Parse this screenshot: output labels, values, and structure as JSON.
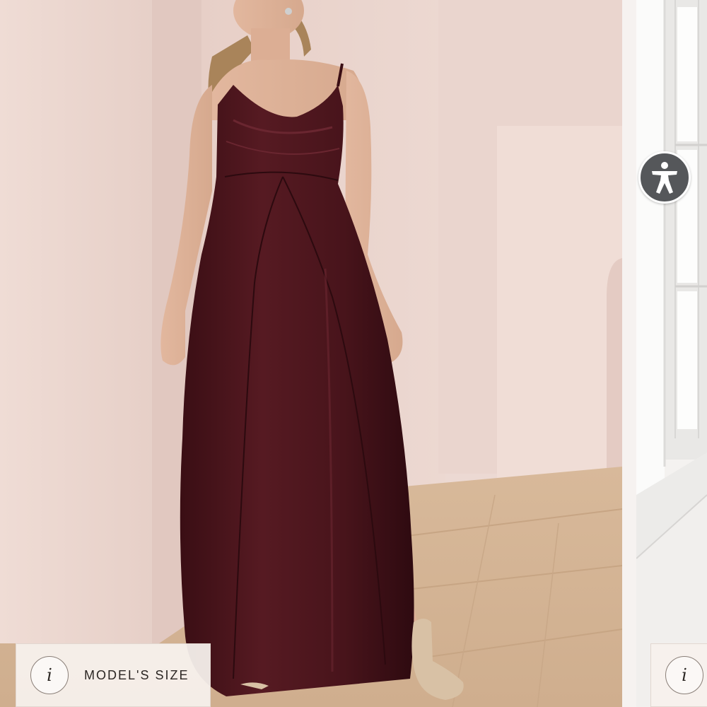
{
  "product_image": {
    "alt_icon": "product-photo",
    "dress_color": "#4a141c"
  },
  "size_pill": {
    "label": "MODEL'S SIZE",
    "info_glyph": "i"
  },
  "size_pill_next": {
    "info_glyph": "i"
  },
  "accessibility_button": {
    "icon": "accessibility-person-icon",
    "color": "#55575a"
  }
}
